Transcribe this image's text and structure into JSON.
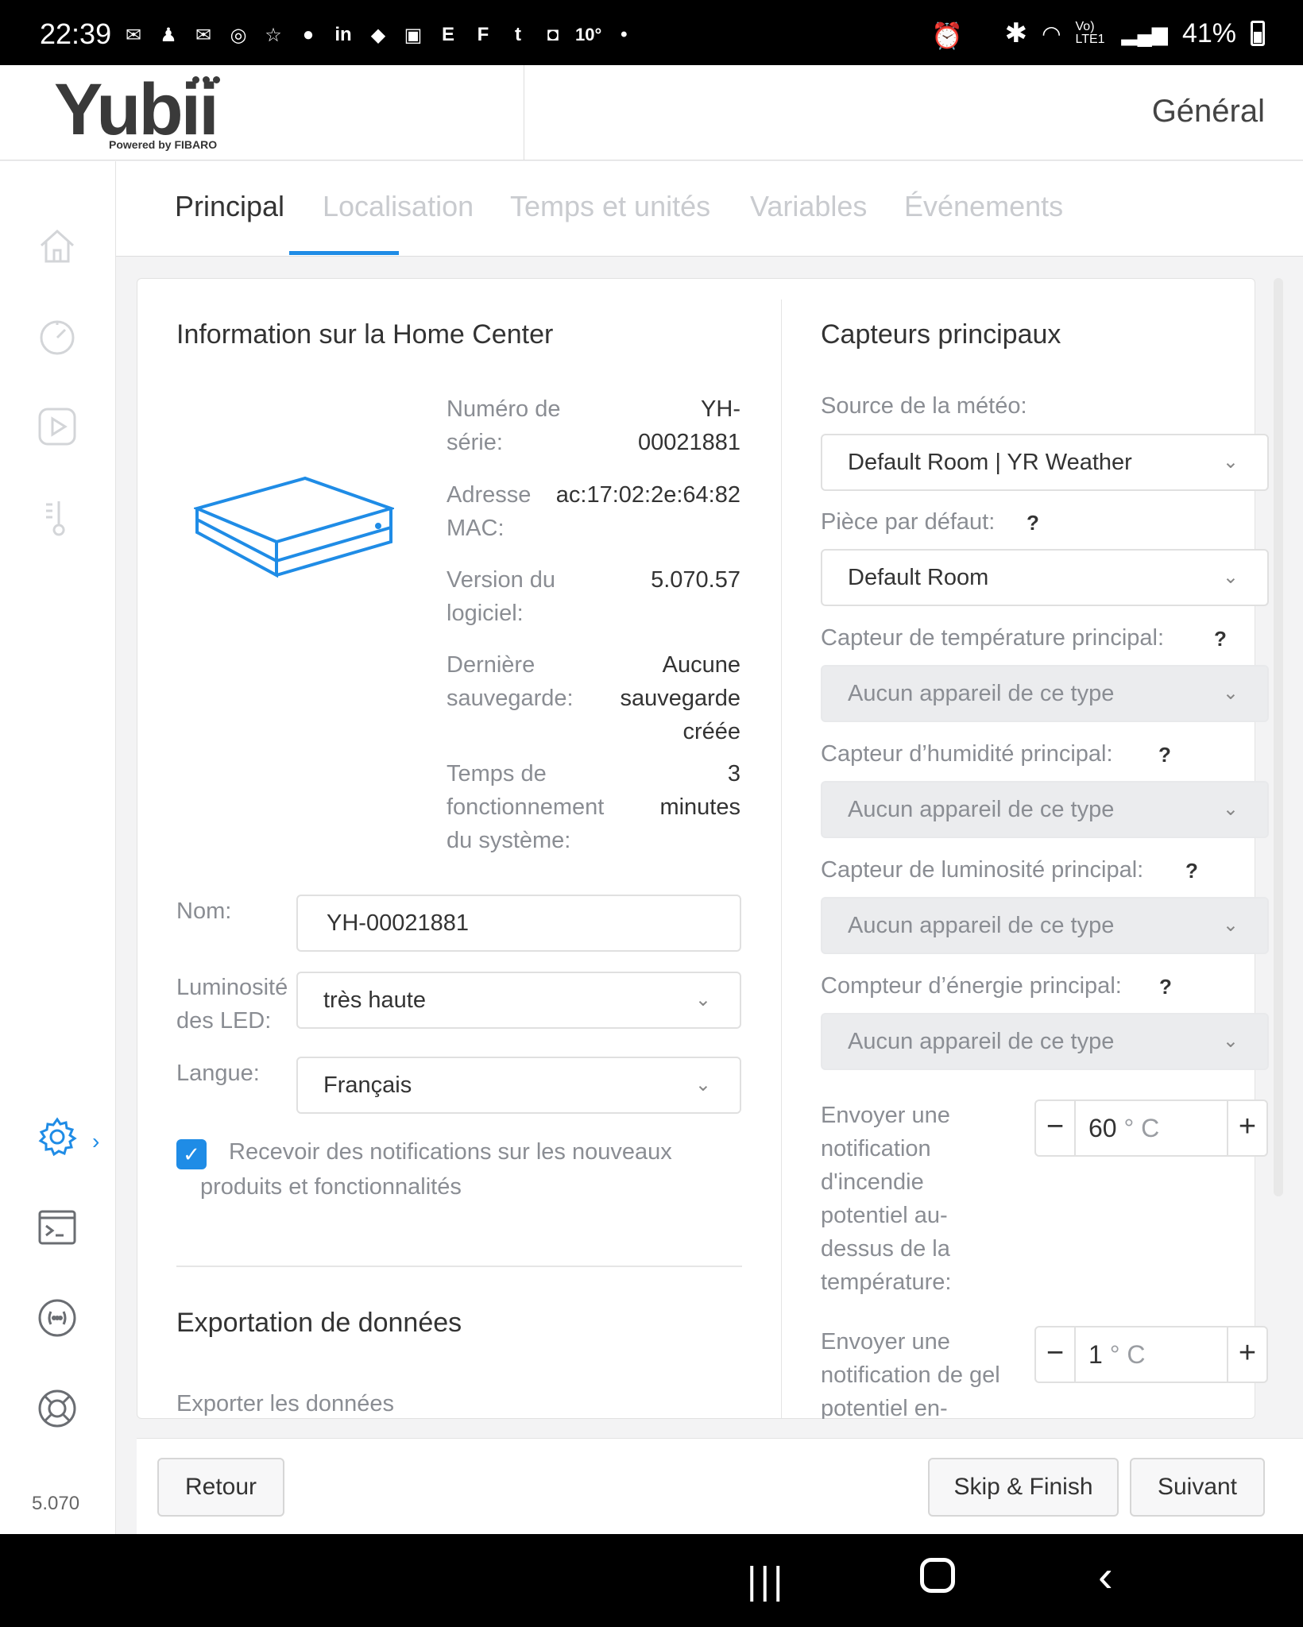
{
  "status_bar": {
    "time": "22:39",
    "temperature": "10°",
    "network": "Vo) LTE1",
    "battery": "41%"
  },
  "header": {
    "logo": "Yubii",
    "logo_sub": "Powered by FIBARO",
    "title": "Général"
  },
  "sidebar": {
    "items": [
      "home-icon",
      "dashboard-icon",
      "scenes-icon",
      "climate-icon",
      "settings-icon",
      "terminal-icon",
      "integrations-icon",
      "support-icon"
    ],
    "version": "5.070"
  },
  "tabs": [
    "Principal",
    "Localisation",
    "Temps et unités",
    "Variables",
    "Événements"
  ],
  "left": {
    "section_title": "Information sur la Home Center",
    "info": [
      {
        "label_1": "Numéro de",
        "label_2": "série:",
        "value_1": "YH-",
        "value_2": "00021881"
      },
      {
        "label_1": "Adresse",
        "label_2": "MAC:",
        "value_1": "ac:17:02:2e:64:82"
      },
      {
        "label_1": "Version du",
        "label_2": "logiciel:",
        "value_1": "5.070.57"
      },
      {
        "label_1": "Dernière",
        "label_2": "sauvegarde:",
        "value_1": "Aucune",
        "value_2": "sauvegarde",
        "value_3": "créée"
      },
      {
        "label_1": "Temps de",
        "label_2": "fonctionnement",
        "label_3": "du système:",
        "value_1": "3",
        "value_2": "minutes"
      }
    ],
    "name_label": "Nom:",
    "name_value": "YH-00021881",
    "led_label_1": "Luminosité",
    "led_label_2": "des LED:",
    "led_value": "très haute",
    "lang_label": "Langue:",
    "lang_value": "Français",
    "notif_checkbox": "Recevoir des notifications sur les nouveaux produits et fonctionnalités",
    "export_title": "Exportation de données",
    "export_label": "Exporter les données"
  },
  "right": {
    "section_title": "Capteurs principaux",
    "weather_label": "Source de la météo:",
    "weather_value": "Default Room | YR Weather",
    "room_label": "Pièce par défaut:",
    "room_value": "Default Room",
    "temp_label": "Capteur de température principal:",
    "humidity_label": "Capteur d’humidité principal:",
    "lux_label": "Capteur de luminosité principal:",
    "energy_label": "Compteur d’énergie principal:",
    "none_value": "Aucun appareil de ce type",
    "help_mark": "?",
    "fire_label": [
      "Envoyer une",
      "notification",
      "d'incendie",
      "potentiel au-",
      "dessus de la",
      "température:"
    ],
    "fire_value": "60",
    "frost_label": [
      "Envoyer une",
      "notification de gel",
      "potentiel en-"
    ],
    "frost_value": "1",
    "unit": "° C",
    "minus": "−",
    "plus": "+"
  },
  "footer": {
    "back": "Retour",
    "skip": "Skip & Finish",
    "next": "Suivant"
  },
  "colors": {
    "accent": "#1f8ce6",
    "disabled_bg": "#ebecee",
    "muted_text": "#8a8d93"
  }
}
